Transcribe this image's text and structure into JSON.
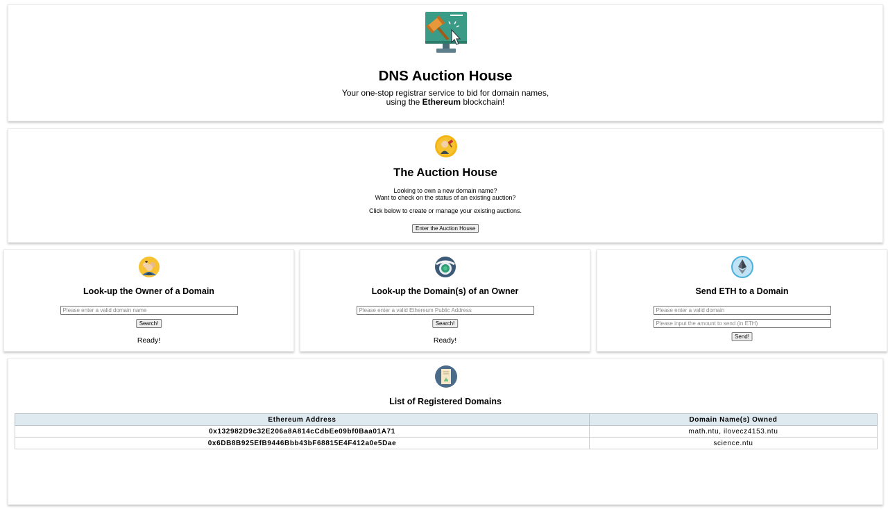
{
  "hero": {
    "title": "DNS Auction House",
    "tagline_1": "Your one-stop registrar service to bid for domain names,",
    "tagline_2_pre": "using the ",
    "tagline_2_bold": "Ethereum",
    "tagline_2_post": " blockchain!",
    "logo_icon": "gavel-on-monitor-icon"
  },
  "auction": {
    "title": "The Auction House",
    "line_1": "Looking to own a new domain name?",
    "line_2": "Want to check on the status of an existing auction?",
    "line_3": "Click below to create or manage your existing auctions.",
    "button": "Enter the Auction House",
    "icon": "auctioneer-icon"
  },
  "owner_lookup": {
    "title": "Look-up the Owner of a Domain",
    "placeholder": "Please enter a valid domain name",
    "button": "Search!",
    "status": "Ready!",
    "icon": "people-icon"
  },
  "domain_lookup": {
    "title": "Look-up the Domain(s) of an Owner",
    "placeholder": "Please enter a valid Ethereum Public Address",
    "button": "Search!",
    "status": "Ready!",
    "icon": "webcam-icon"
  },
  "send_eth": {
    "title": "Send ETH to a Domain",
    "placeholder_domain": "Please enter a valid domain",
    "placeholder_amount": "Please input the amount to send (in ETH)",
    "button": "Send!",
    "icon": "ethereum-icon"
  },
  "registry": {
    "title": "List of Registered Domains",
    "icon": "certificate-icon",
    "columns": [
      "Ethereum Address",
      "Domain Name(s) Owned"
    ],
    "rows": [
      {
        "address": "0x132982D9c32E206a8A814cCdbEe09bf0Baa01A71",
        "domains": "math.ntu, ilovecz4153.ntu"
      },
      {
        "address": "0x6DB8B925EfB9446Bbb43bF68815E4F412a0e5Dae",
        "domains": "science.ntu"
      }
    ]
  },
  "colors": {
    "table_header_bg": "#dfeaf0",
    "monitor_screen": "#3a9b86",
    "gavel": "#e8973a"
  }
}
